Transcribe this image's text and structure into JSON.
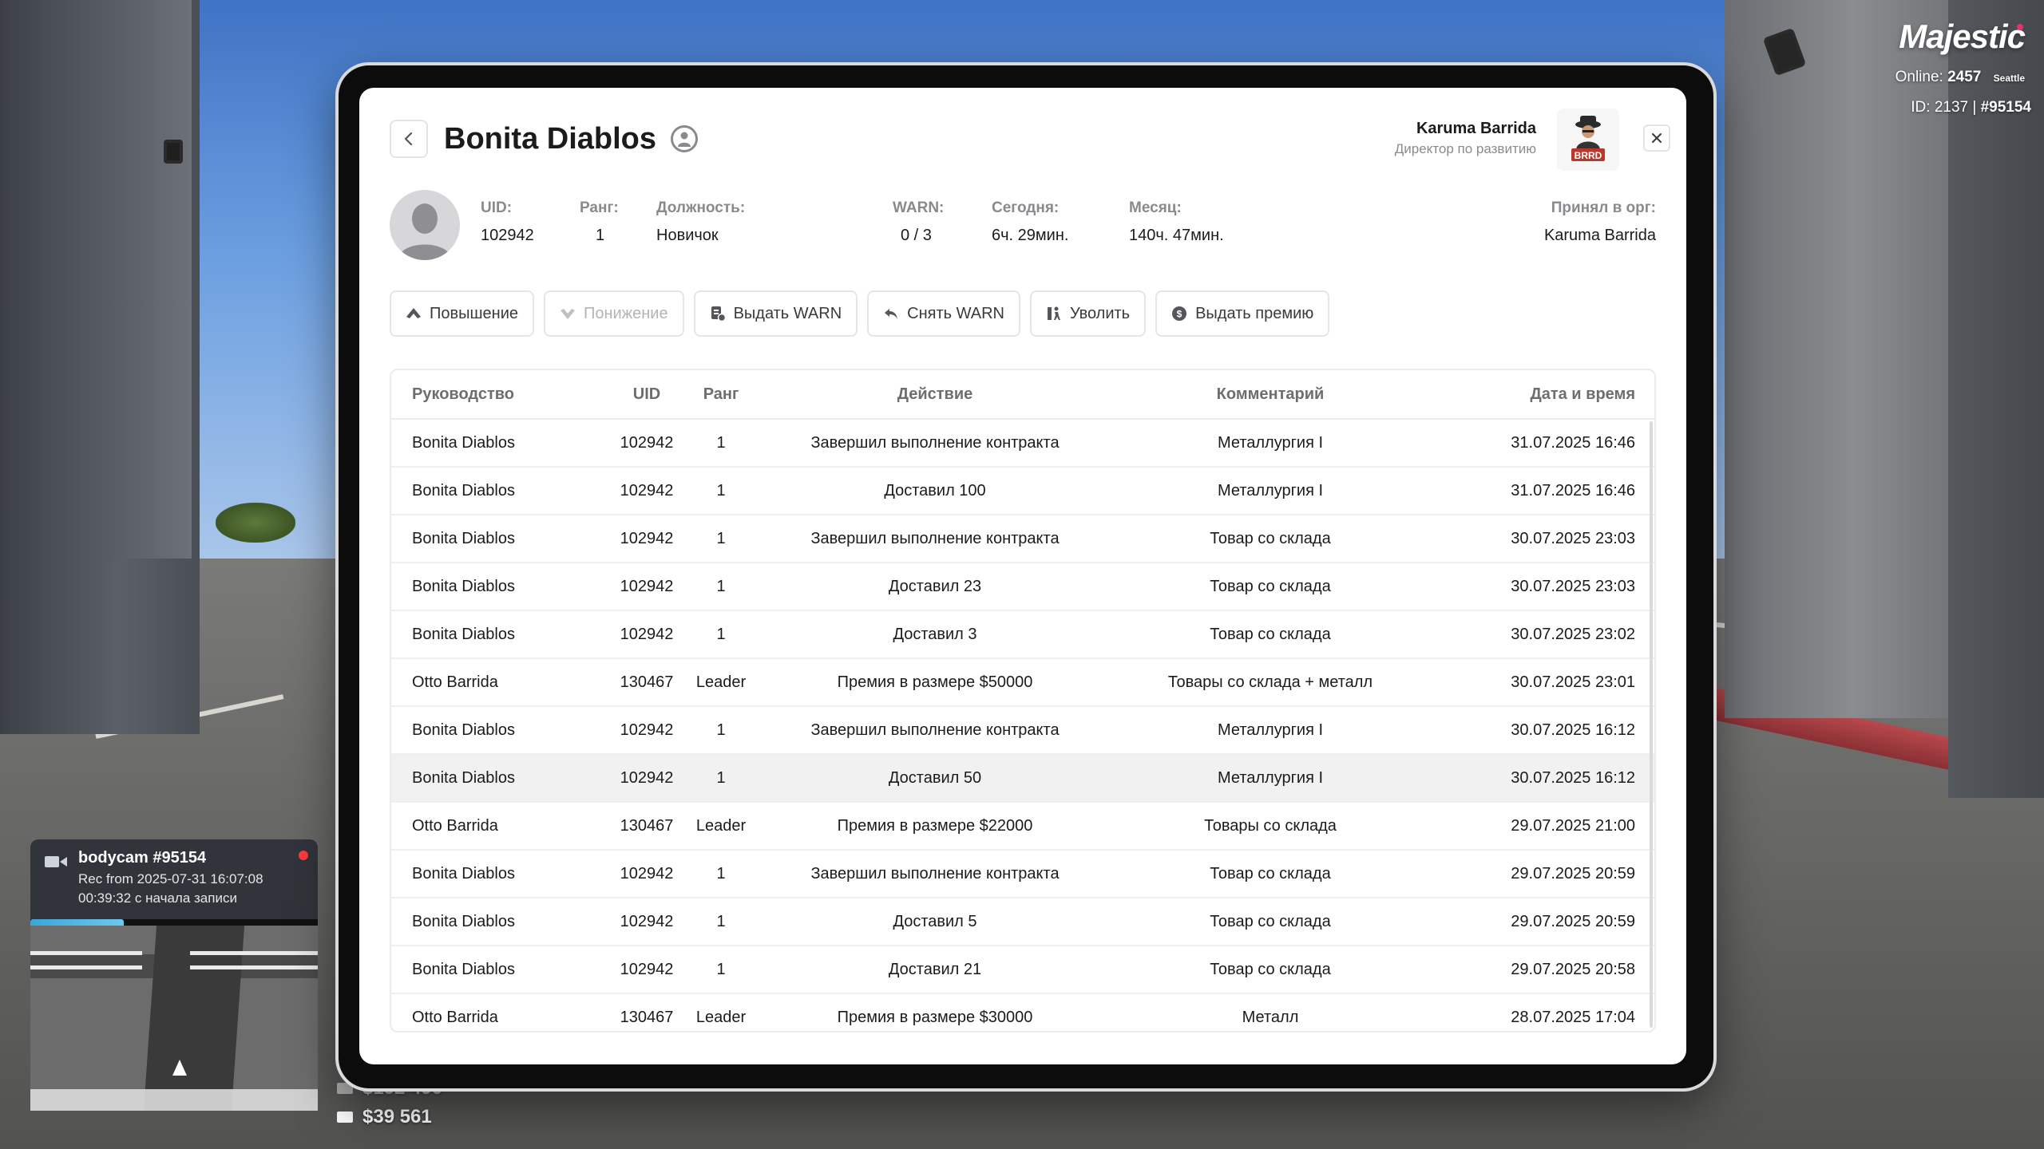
{
  "hud": {
    "logo": "Majestic",
    "online_label": "Online:",
    "online_count": "2457",
    "server": "Seattle",
    "id_label": "ID: 2137 |",
    "id_value": "#95154"
  },
  "bodycam": {
    "title": "bodycam #95154",
    "rec": "Rec from 2025-07-31 16:07:08",
    "elapsed": "00:39:32 с начала записи",
    "progress_fraction": 0.37
  },
  "money": {
    "bank": "$192 490",
    "cash": "$39 561"
  },
  "header": {
    "title": "Bonita Diablos",
    "org_user_name": "Karuma Barrida",
    "org_user_role": "Директор по развитию",
    "org_logo_text": "BRRD"
  },
  "info": {
    "uid_label": "UID:",
    "uid": "102942",
    "rank_label": "Ранг:",
    "rank": "1",
    "position_label": "Должность:",
    "position": "Новичок",
    "warn_label": "WARN:",
    "warn": "0 / 3",
    "today_label": "Сегодня:",
    "today": "6ч. 29мин.",
    "month_label": "Месяц:",
    "month": "140ч. 47мин.",
    "accepted_label": "Принял в орг:",
    "accepted": "Karuma Barrida"
  },
  "actions": {
    "promote": "Повышение",
    "demote": "Понижение",
    "give_warn": "Выдать WARN",
    "remove_warn": "Снять WARN",
    "fire": "Уволить",
    "bonus": "Выдать премию"
  },
  "table": {
    "columns": [
      "Руководство",
      "UID",
      "Ранг",
      "Действие",
      "Комментарий",
      "Дата и время"
    ],
    "rows": [
      [
        "Bonita Diablos",
        "102942",
        "1",
        "Завершил выполнение контракта",
        "Металлургия I",
        "31.07.2025 16:46"
      ],
      [
        "Bonita Diablos",
        "102942",
        "1",
        "Доставил 100",
        "Металлургия I",
        "31.07.2025 16:46"
      ],
      [
        "Bonita Diablos",
        "102942",
        "1",
        "Завершил выполнение контракта",
        "Товар со склада",
        "30.07.2025 23:03"
      ],
      [
        "Bonita Diablos",
        "102942",
        "1",
        "Доставил 23",
        "Товар со склада",
        "30.07.2025 23:03"
      ],
      [
        "Bonita Diablos",
        "102942",
        "1",
        "Доставил 3",
        "Товар со склада",
        "30.07.2025 23:02"
      ],
      [
        "Otto Barrida",
        "130467",
        "Leader",
        "Премия в размере $50000",
        "Товары со склада + металл",
        "30.07.2025 23:01"
      ],
      [
        "Bonita Diablos",
        "102942",
        "1",
        "Завершил выполнение контракта",
        "Металлургия I",
        "30.07.2025 16:12"
      ],
      [
        "Bonita Diablos",
        "102942",
        "1",
        "Доставил 50",
        "Металлургия I",
        "30.07.2025 16:12"
      ],
      [
        "Otto Barrida",
        "130467",
        "Leader",
        "Премия в размере $22000",
        "Товары со склада",
        "29.07.2025 21:00"
      ],
      [
        "Bonita Diablos",
        "102942",
        "1",
        "Завершил выполнение контракта",
        "Товар со склада",
        "29.07.2025 20:59"
      ],
      [
        "Bonita Diablos",
        "102942",
        "1",
        "Доставил 5",
        "Товар со склада",
        "29.07.2025 20:59"
      ],
      [
        "Bonita Diablos",
        "102942",
        "1",
        "Доставил 21",
        "Товар со склада",
        "29.07.2025 20:58"
      ],
      [
        "Otto Barrida",
        "130467",
        "Leader",
        "Премия в размере $30000",
        "Металл",
        "28.07.2025 17:04"
      ]
    ],
    "highlighted_row": 7
  },
  "colors": {
    "accent_logo_dot": "#e8306a",
    "rec_dot": "#ff3b3b",
    "progress": "#3aa6d8"
  }
}
